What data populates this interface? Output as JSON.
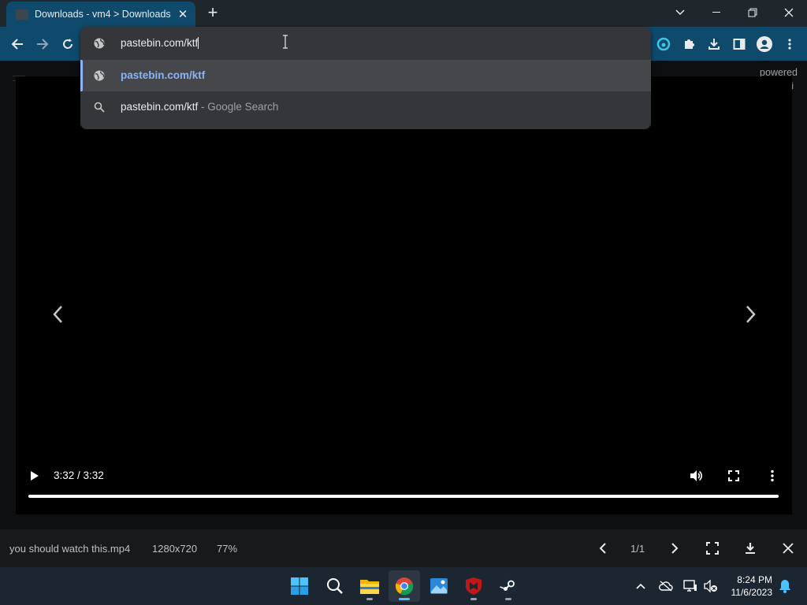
{
  "browser": {
    "tab_title": "Downloads - vm4 > Downloads",
    "new_tab_label": "+",
    "omnibox_text": "pastebin.com/ktf",
    "suggestions": [
      {
        "text": "pastebin.com/ktf",
        "desc": "",
        "icon": "globe-icon"
      },
      {
        "text": "pastebin.com/ktf",
        "desc": " - Google Search",
        "icon": "search-icon"
      }
    ]
  },
  "page": {
    "powered_text": "powered",
    "powered_i": "i"
  },
  "video": {
    "time": "3:32 / 3:32",
    "progress": 1.0
  },
  "infobar": {
    "filename": "you should watch this.mp4",
    "dimensions": "1280x720",
    "zoom": "77%",
    "pager": "1/1"
  },
  "taskbar": {
    "time": "8:24 PM",
    "date": "11/6/2023",
    "apps": [
      "windows-start",
      "search",
      "file-explorer",
      "chrome",
      "photos",
      "mcafee",
      "steam"
    ]
  },
  "colors": {
    "toolbar": "#0f4a6c",
    "suggestion_link": "#8ab4f8",
    "taskbar": "#1c2630"
  }
}
